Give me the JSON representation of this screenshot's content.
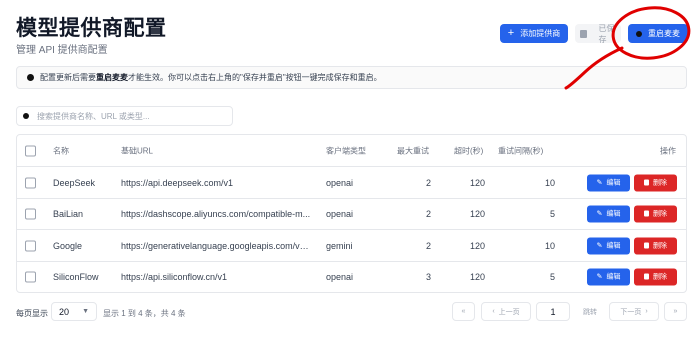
{
  "header": {
    "title": "模型提供商配置",
    "subtitle": "管理 API 提供商配置",
    "add_label": "添加提供商",
    "save_label": "已保存",
    "restart_label": "重启麦麦"
  },
  "notice": {
    "prefix": "配置更新后需要",
    "emphasis": "重启麦麦",
    "suffix": "才能生效。你可以点击右上角的\"保存并重启\"按钮一键完成保存和重启。"
  },
  "search": {
    "placeholder": "搜索提供商名称、URL 或类型..."
  },
  "table": {
    "columns": {
      "name": "名称",
      "url": "基础URL",
      "client": "客户端类型",
      "retry": "最大重试",
      "timeout": "超时(秒)",
      "interval": "重试间隔(秒)",
      "actions": "操作"
    },
    "rows": [
      {
        "name": "DeepSeek",
        "url": "https://api.deepseek.com/v1",
        "client": "openai",
        "retry": "2",
        "timeout": "120",
        "interval": "10"
      },
      {
        "name": "BaiLian",
        "url": "https://dashscope.aliyuncs.com/compatible-m...",
        "client": "openai",
        "retry": "2",
        "timeout": "120",
        "interval": "5"
      },
      {
        "name": "Google",
        "url": "https://generativelanguage.googleapis.com/v1...",
        "client": "gemini",
        "retry": "2",
        "timeout": "120",
        "interval": "10"
      },
      {
        "name": "SiliconFlow",
        "url": "https://api.siliconflow.cn/v1",
        "client": "openai",
        "retry": "3",
        "timeout": "120",
        "interval": "5"
      }
    ],
    "edit_label": "编辑",
    "delete_label": "删除"
  },
  "footer": {
    "per_page_label": "每页显示",
    "per_page_value": "20",
    "info": "显示 1 到 4 条，共 4 条",
    "prev_label": "上一页",
    "page_value": "1",
    "jump_label": "跳转",
    "next_label": "下一页"
  },
  "colors": {
    "primary": "#2563eb",
    "danger": "#dc2626",
    "annotation": "#e00000"
  }
}
